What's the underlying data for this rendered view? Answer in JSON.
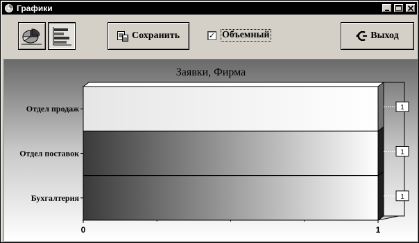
{
  "window": {
    "title": "Графики",
    "buttons": {
      "minimize": "_",
      "maximize": "□",
      "close": "✕"
    }
  },
  "toolbar": {
    "pie_chart_icon": "pie-chart-icon",
    "bar_chart_icon": "bar-chart-icon",
    "save_label": "Сохранить",
    "volumetric_label": "Объемный",
    "volumetric_checked": true,
    "volumetric_check_glyph": "✓",
    "exit_label": "Выход"
  },
  "chart_data": {
    "type": "bar",
    "orientation": "horizontal",
    "three_d": true,
    "title": "Заявки, Фирма",
    "categories": [
      "Отдел продаж",
      "Отдел поставок",
      "Бухгалтерия"
    ],
    "values": [
      1,
      1,
      1
    ],
    "data_labels": [
      "1",
      "1",
      "1"
    ],
    "xlim": [
      0,
      1
    ],
    "x_ticks": [
      "0",
      "1"
    ],
    "grid": true
  }
}
